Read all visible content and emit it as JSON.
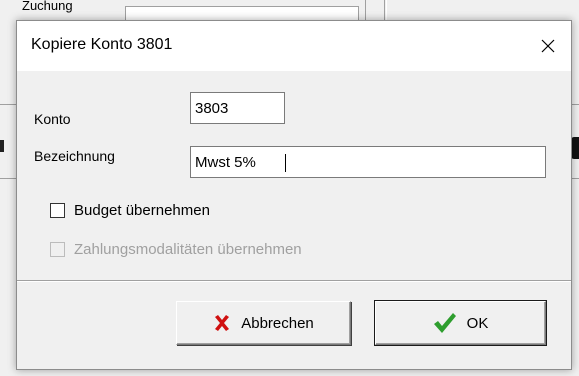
{
  "background": {
    "top_label": "Zuchung"
  },
  "dialog": {
    "title": "Kopiere Konto 3801",
    "close_icon": "close-icon",
    "fields": {
      "konto_label": "Konto",
      "konto_value": "3803",
      "bezeichnung_label": "Bezeichnung",
      "bezeichnung_value": "Mwst 5%"
    },
    "checkboxes": [
      {
        "label": "Budget übernehmen",
        "checked": false,
        "enabled": true
      },
      {
        "label": "Zahlungsmodalitäten übernehmen",
        "checked": false,
        "enabled": false
      }
    ],
    "buttons": {
      "cancel_label": "Abbrechen",
      "cancel_icon": "red-x-icon",
      "ok_label": "OK",
      "ok_icon": "green-check-icon"
    }
  },
  "colors": {
    "cancel_icon": "#d01010",
    "ok_icon": "#2e9e2e",
    "disabled_text": "#a0a0a0"
  }
}
